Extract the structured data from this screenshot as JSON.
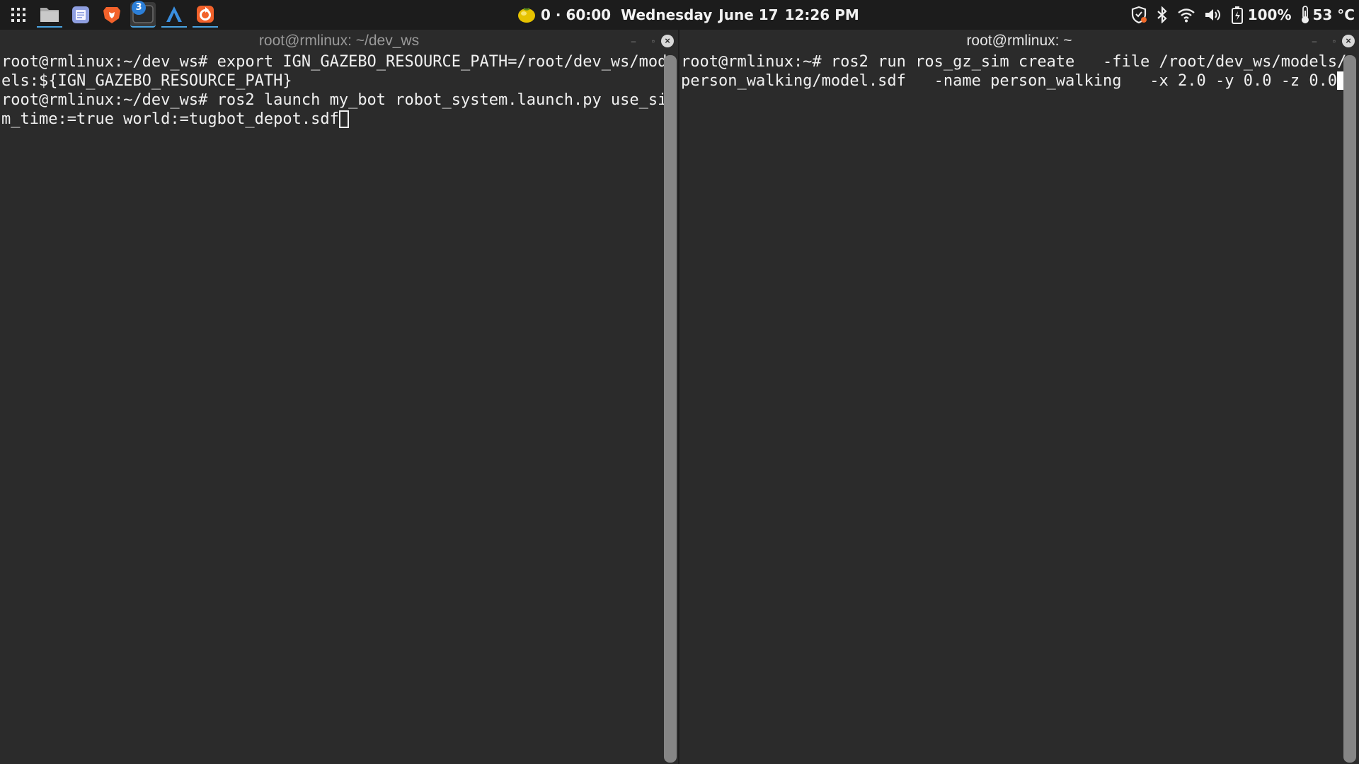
{
  "topbar": {
    "pomodoro": "0 · 60:00",
    "day": "Wednesday",
    "date": "June 17",
    "time": "12:26 PM",
    "battery": "100%",
    "temperature": "53 °C",
    "terminal_badge": "3",
    "apps": [
      "app-grid-icon",
      "files-icon",
      "text-editor-icon",
      "brave-browser-icon",
      "terminal-icon",
      "arch-launcher-icon",
      "update-icon"
    ],
    "tray": [
      "shield-icon",
      "bluetooth-icon",
      "wifi-icon",
      "volume-icon",
      "battery-icon",
      "thermometer-icon"
    ]
  },
  "terminals": {
    "left": {
      "title": "root@rmlinux: ~/dev_ws",
      "lines": [
        "root@rmlinux:~/dev_ws# export IGN_GAZEBO_RESOURCE_PATH=/root/dev_ws/mod",
        "els:${IGN_GAZEBO_RESOURCE_PATH}",
        "root@rmlinux:~/dev_ws# ros2 launch my_bot robot_system.launch.py use_si",
        "m_time:=true world:=tugbot_depot.sdf"
      ]
    },
    "right": {
      "title": "root@rmlinux: ~",
      "lines": [
        "root@rmlinux:~# ros2 run ros_gz_sim create   -file /root/dev_ws/models/",
        "person_walking/model.sdf   -name person_walking   -x 2.0 -y 0.0 -z 0.0"
      ]
    }
  },
  "colors": {
    "panel_bg": "#1c1c1c",
    "terminal_bg": "#2b2b2b",
    "text": "#f0f0f0",
    "accent": "#4aa3df"
  }
}
